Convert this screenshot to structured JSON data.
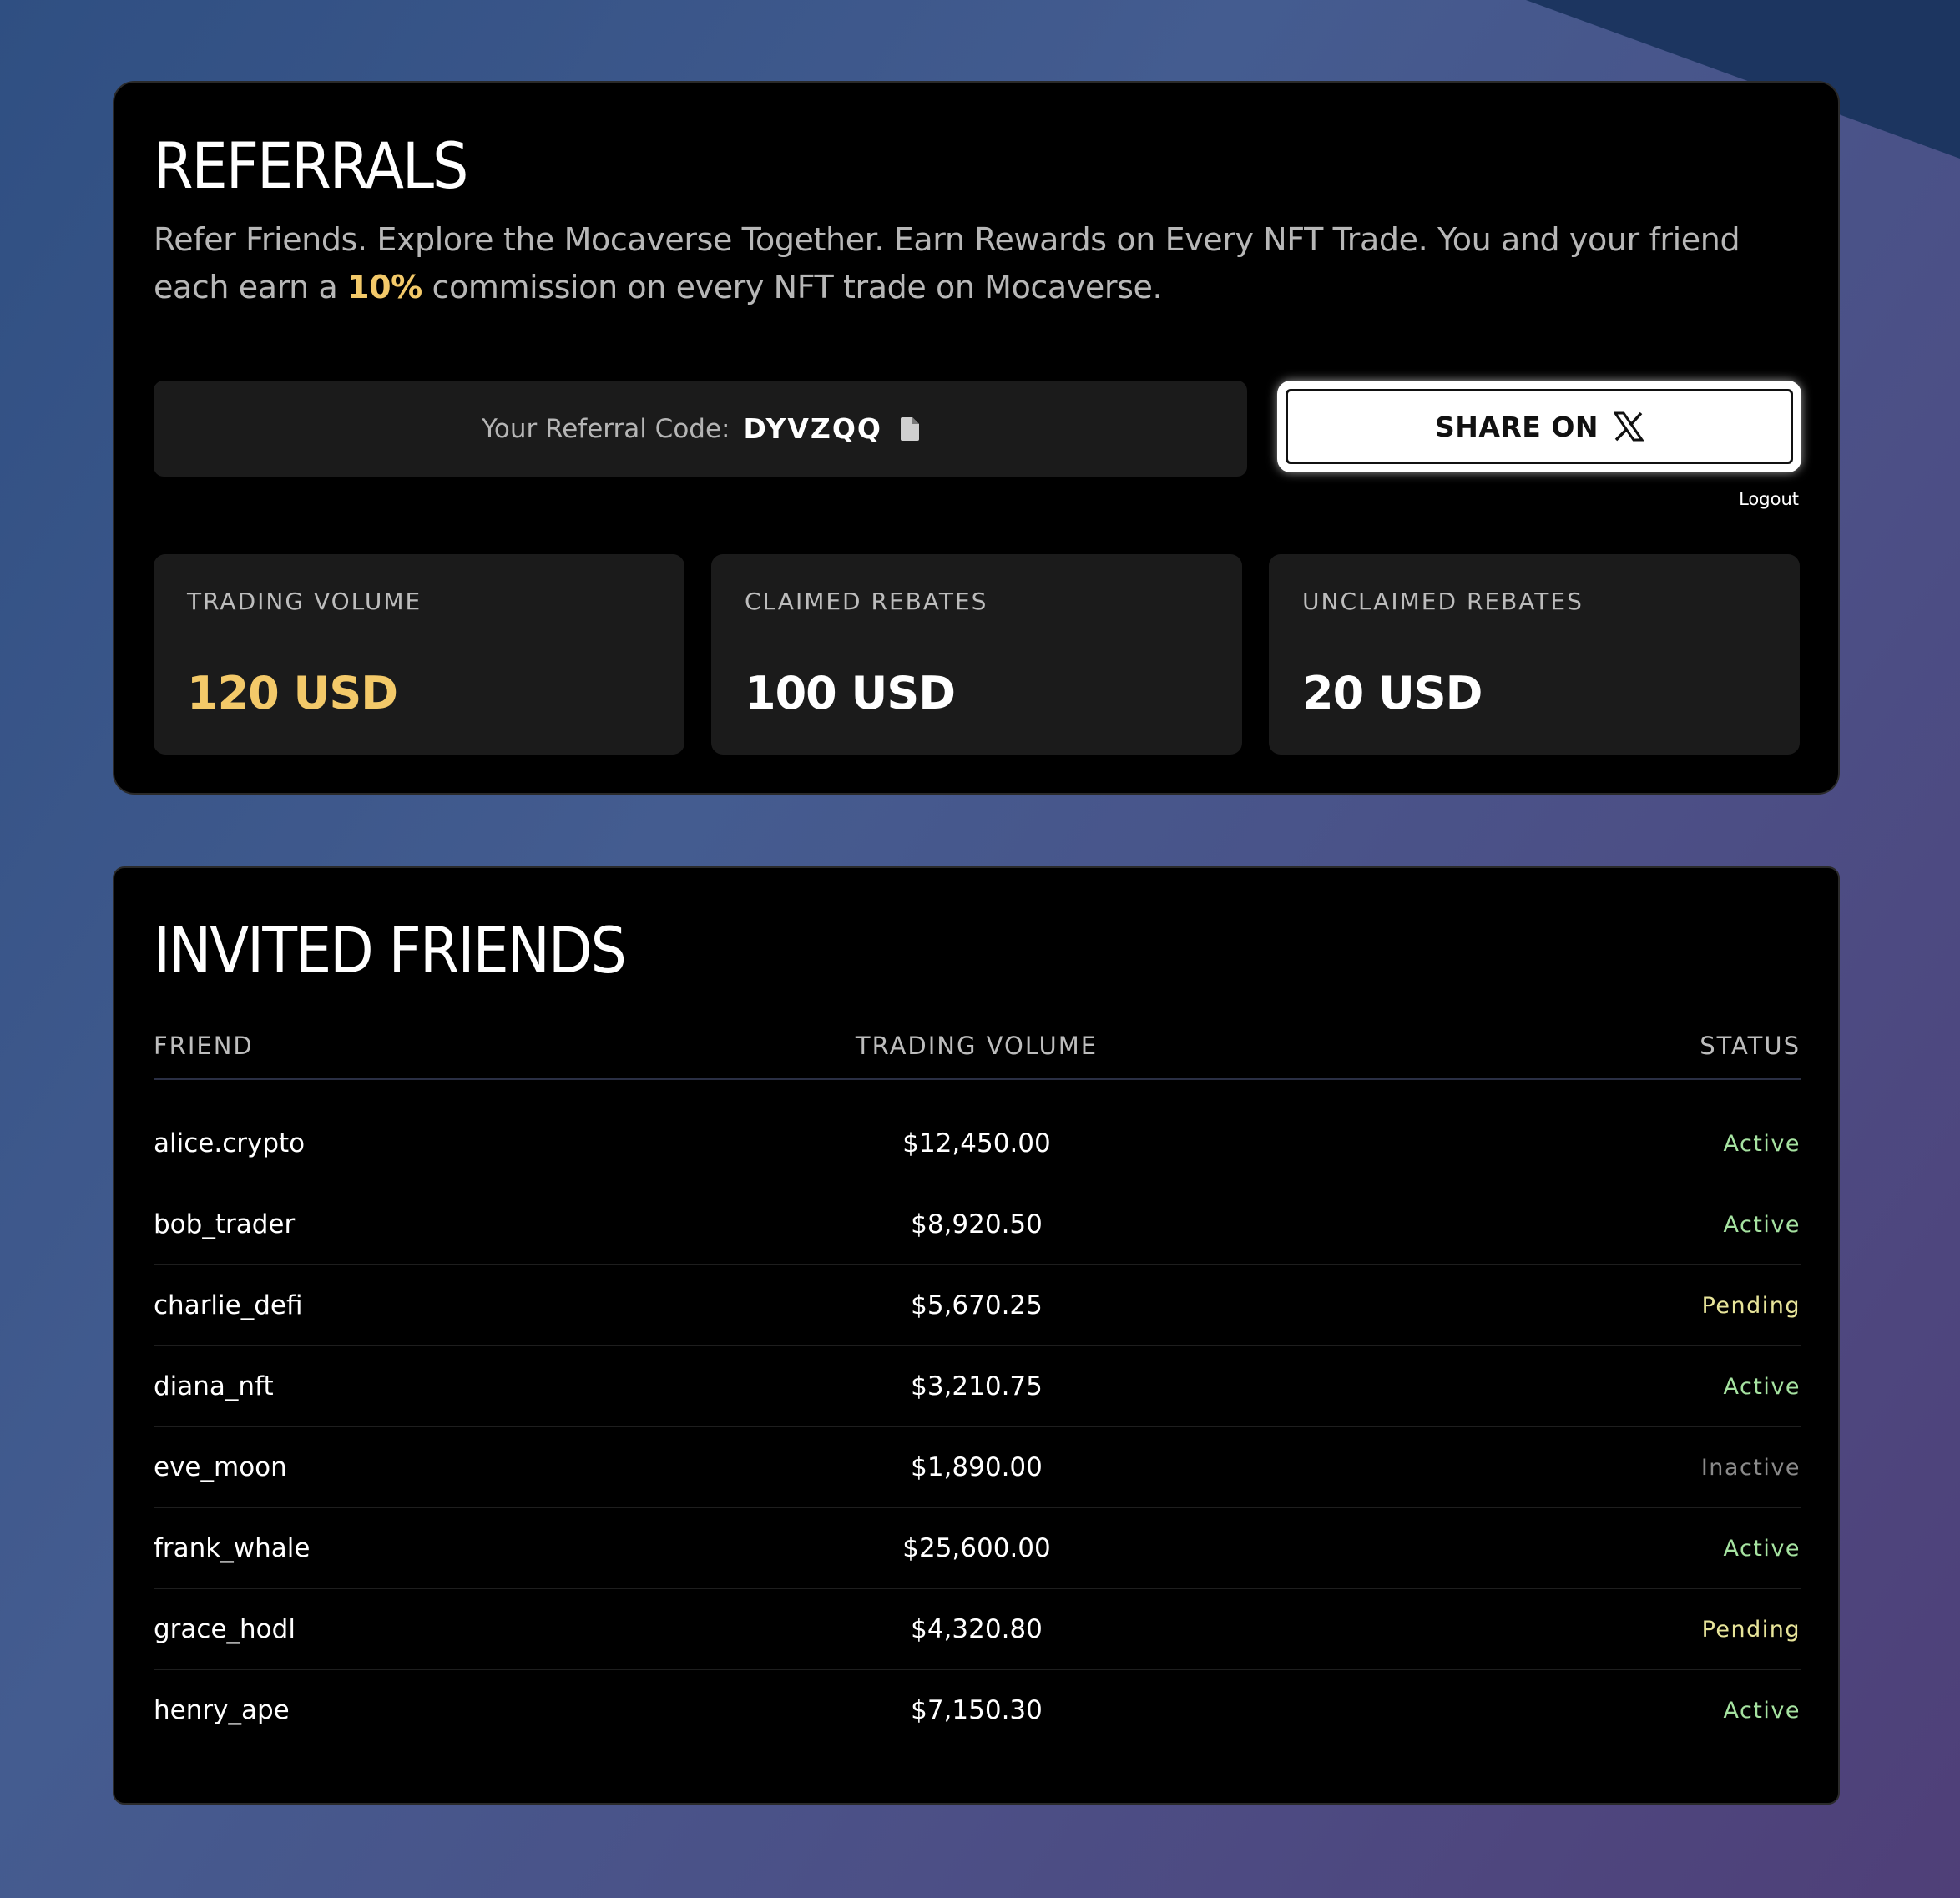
{
  "referrals": {
    "title": "REFERRALS",
    "description_part1": "Refer Friends. Explore the Mocaverse Together. Earn Rewards on Every NFT Trade. You and your friend each earn a",
    "commission_rate": "10%",
    "description_part2": "commission on every NFT trade on Mocaverse.",
    "code_label": "Your Referral Code:",
    "code_value": "DYVZQQ",
    "copy_icon": "copy-document-icon",
    "share_label": "SHARE ON",
    "share_icon": "x-logo-icon",
    "logout_label": "Logout",
    "stats": [
      {
        "label": "TRADING VOLUME",
        "value": "120 USD"
      },
      {
        "label": "CLAIMED REBATES",
        "value": "100 USD"
      },
      {
        "label": "UNCLAIMED REBATES",
        "value": "20 USD"
      }
    ]
  },
  "friends": {
    "title": "INVITED FRIENDS",
    "columns": {
      "friend": "FRIEND",
      "volume": "TRADING VOLUME",
      "status": "STATUS"
    },
    "rows": [
      {
        "friend": "alice.crypto",
        "volume": "$12,450.00",
        "status": "Active"
      },
      {
        "friend": "bob_trader",
        "volume": "$8,920.50",
        "status": "Active"
      },
      {
        "friend": "charlie_defi",
        "volume": "$5,670.25",
        "status": "Pending"
      },
      {
        "friend": "diana_nft",
        "volume": "$3,210.75",
        "status": "Active"
      },
      {
        "friend": "eve_moon",
        "volume": "$1,890.00",
        "status": "Inactive"
      },
      {
        "friend": "frank_whale",
        "volume": "$25,600.00",
        "status": "Active"
      },
      {
        "friend": "grace_hodl",
        "volume": "$4,320.80",
        "status": "Pending"
      },
      {
        "friend": "henry_ape",
        "volume": "$7,150.30",
        "status": "Active"
      }
    ]
  },
  "colors": {
    "accent_gold": "#f3c969",
    "status_active": "#a6e3a1",
    "status_pending": "#e8e59a",
    "status_inactive": "#8a8a8a"
  }
}
